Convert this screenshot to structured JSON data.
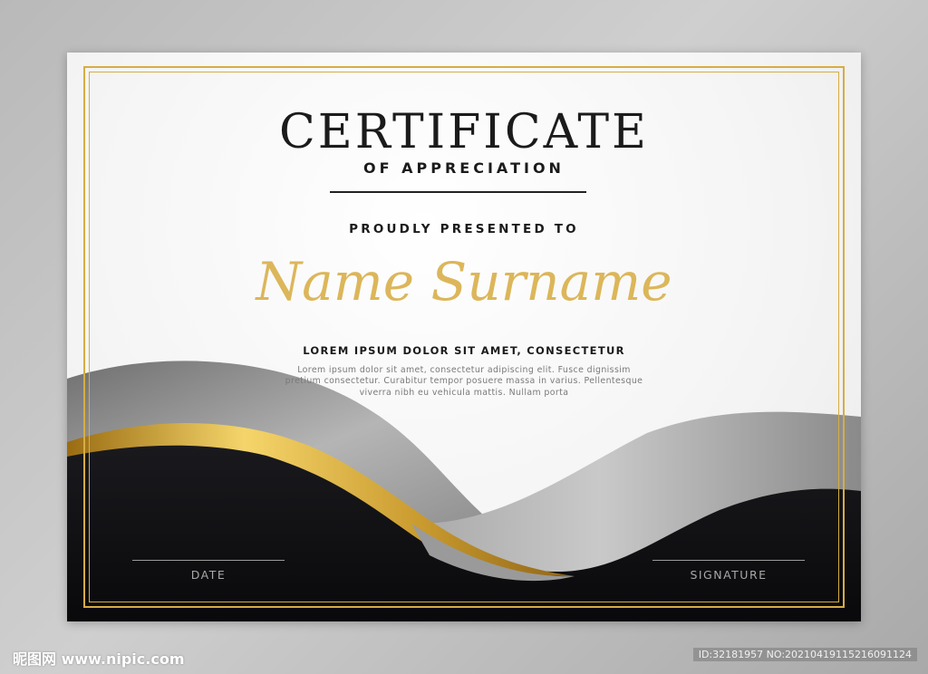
{
  "certificate": {
    "title": "CERTIFICATE",
    "subtitle": "OF APPRECIATION",
    "presented_to": "PROUDLY PRESENTED TO",
    "recipient_name": "Name Surname",
    "lorem_heading": "LOREM IPSUM DOLOR SIT AMET, CONSECTETUR",
    "lorem_body": "Lorem ipsum dolor sit amet, consectetur adipiscing elit. Fusce dignissim pretium consectetur. Curabitur tempor posuere massa in varius. Pellentesque viverra nibh eu vehicula mattis. Nullam porta",
    "date_label": "DATE",
    "signature_label": "SIGNATURE"
  },
  "colors": {
    "gold": "#d6ad44",
    "name_gold": "#dcb65a",
    "dark_band": "#0e0e11",
    "gray_wave": "#8e8e8e"
  },
  "watermark": {
    "site": "昵图网 www.nipic.com",
    "id_text": "ID:32181957 NO:20210419115216091124"
  }
}
